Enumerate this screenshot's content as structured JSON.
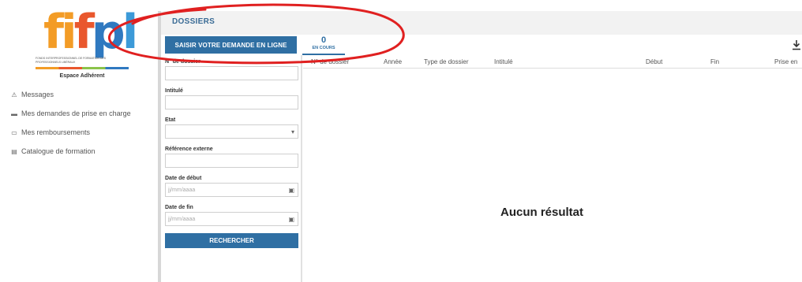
{
  "brand": {
    "logo_parts": [
      "fi",
      "f",
      "p",
      "l"
    ],
    "subtitle": "FONDS INTERPROFESSIONNEL DE FORMATION DES PROFESSIONNELS LIBÉRAUX",
    "espace": "Espace Adhérent",
    "colors": {
      "orange": "#f39c26",
      "red": "#e9572d",
      "blue": "#2f79c0",
      "lightblue": "#3c9ad8"
    }
  },
  "sidebar": {
    "items": [
      {
        "label": "Messages",
        "icon": "warning-icon"
      },
      {
        "label": "Mes demandes de prise en charge",
        "icon": "folder-icon"
      },
      {
        "label": "Mes remboursements",
        "icon": "card-icon"
      },
      {
        "label": "Catalogue de formation",
        "icon": "catalog-icon"
      }
    ]
  },
  "header": {
    "title": "DOSSIERS",
    "action_label": "SAISIR VOTRE DEMANDE EN LIGNE",
    "counter_value": "0",
    "counter_label": "EN COURS"
  },
  "form": {
    "fields": [
      {
        "label": "N° de dossier",
        "placeholder": ""
      },
      {
        "label": "Intitulé",
        "placeholder": ""
      },
      {
        "label": "Etat",
        "value": ""
      },
      {
        "label": "Référence externe",
        "placeholder": ""
      },
      {
        "label": "Date de début",
        "placeholder": "jj/mm/aaaa"
      },
      {
        "label": "Date de fin",
        "placeholder": "jj/mm/aaaa"
      }
    ],
    "search_label": "RECHERCHER"
  },
  "table": {
    "columns": [
      "N° de dossier",
      "Année",
      "Type de dossier",
      "Intitulé",
      "Début",
      "Fin",
      "Prise en"
    ],
    "empty_message": "Aucun résultat"
  },
  "accent_color": "#2f6fa3",
  "annotation_color": "#e02020"
}
